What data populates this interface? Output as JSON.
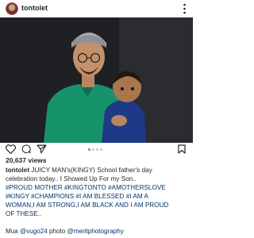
{
  "post": {
    "username": "tontolet",
    "likes": "20,637 views",
    "caption": {
      "username": "tontolet",
      "line1": "JUICY MAN's(KINGY) School father's day",
      "line2": "celebration today.. I Showed Up For my Son..",
      "line3": "#PROUD MOTHER #KINGTONTO #AMOTHERSLOVE",
      "line4": "#KINGY #CHAMPIONS #I AM BLESSED #I AM A",
      "line5": "WOMAN,I AM STRONG,I AM BLACK AND I AM PROUD",
      "line6": "OF THESE.."
    },
    "credit": {
      "prefix": "Mua",
      "makeup": "@vugo24",
      "mid": "photo",
      "photographer": "@meritphotography"
    },
    "carousel": {
      "current": 1,
      "total": 4
    }
  },
  "icons": [
    "more-vertical-icon",
    "heart-icon",
    "comment-icon",
    "share-icon",
    "bookmark-icon"
  ],
  "colors": {
    "accent": "#3897f0",
    "hashtag": "#003569",
    "text": "#262626"
  }
}
